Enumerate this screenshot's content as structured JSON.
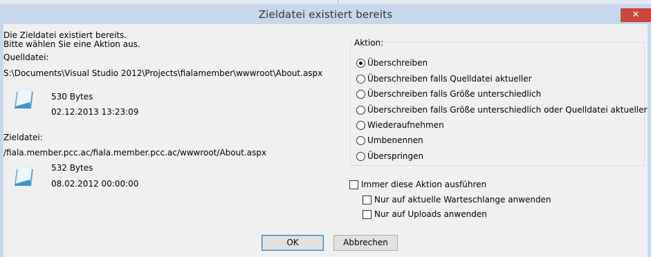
{
  "dialog": {
    "title": "Zieldatei existiert bereits",
    "close_label": "✕"
  },
  "info": {
    "line1": "Die Zieldatei existiert bereits.",
    "line2": "Bitte wählen Sie eine Aktion aus."
  },
  "source": {
    "label": "Quelldatei:",
    "path": "S:\\Documents\\Visual Studio 2012\\Projects\\fialamember\\wwwroot\\About.aspx",
    "size": "530 Bytes",
    "date": "02.12.2013 13:23:09"
  },
  "target": {
    "label": "Zieldatei:",
    "path": "/fiala.member.pcc.ac/fiala.member.pcc.ac/wwwroot/About.aspx",
    "size": "532 Bytes",
    "date": "08.02.2012 00:00:00"
  },
  "action": {
    "group_label": "Aktion:",
    "options": [
      {
        "label": "Überschreiben",
        "checked": true
      },
      {
        "label": "Überschreiben falls Quelldatei aktueller",
        "checked": false
      },
      {
        "label": "Überschreiben falls Größe unterschiedlich",
        "checked": false
      },
      {
        "label": "Überschreiben falls Größe unterschiedlich oder Quelldatei aktueller",
        "checked": false
      },
      {
        "label": "Wiederaufnehmen",
        "checked": false
      },
      {
        "label": "Umbenennen",
        "checked": false
      },
      {
        "label": "Überspringen",
        "checked": false
      }
    ]
  },
  "checkboxes": {
    "always": {
      "label": "Immer diese Aktion ausführen",
      "checked": false
    },
    "queue": {
      "label": "Nur auf aktuelle Warteschlange anwenden",
      "checked": false
    },
    "uploads": {
      "label": "Nur auf Uploads anwenden",
      "checked": false
    }
  },
  "buttons": {
    "ok": "OK",
    "cancel": "Abbrechen"
  }
}
